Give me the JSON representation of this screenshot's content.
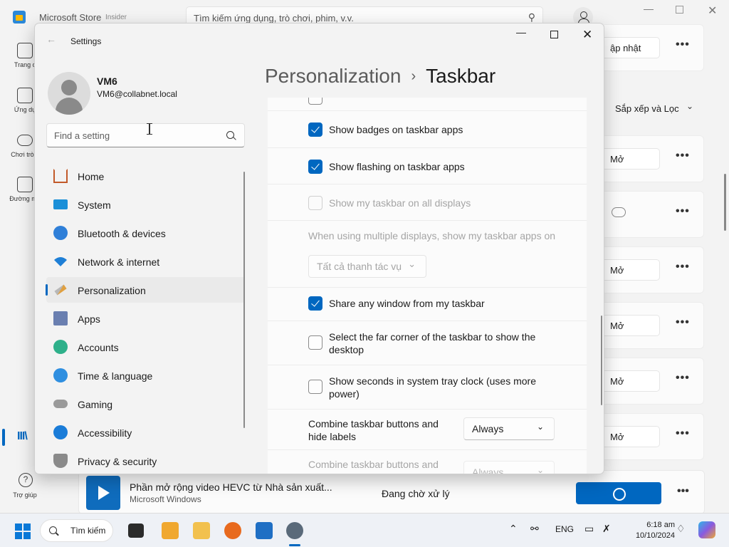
{
  "store": {
    "title": "Microsoft Store",
    "badge": "Insider",
    "search_placeholder": "Tìm kiếm ứng dụng, trò chơi, phim, v.v.",
    "nav": [
      {
        "label": "Trang c",
        "icon": "home-icon"
      },
      {
        "label": "Ứng dụ",
        "icon": "apps-icon"
      },
      {
        "label": "Chơi trò c",
        "icon": "gaming-icon"
      },
      {
        "label": "Đường mà",
        "icon": "movies-icon"
      }
    ],
    "help_label": "Trợ giúp",
    "update_label": "ập nhật",
    "sort_label": "Sắp xếp và Lọc",
    "open_label": "Mở",
    "more_label": "•••",
    "bottom_item": {
      "name": "Phần mở rộng video HEVC từ Nhà sản xuất...",
      "publisher": "Microsoft Windows",
      "status": "Đang chờ xử lý"
    }
  },
  "settings": {
    "window_title": "Settings",
    "user": {
      "name": "VM6",
      "email": "VM6@collabnet.local"
    },
    "search_placeholder": "Find a setting",
    "breadcrumb": {
      "parent": "Personalization",
      "separator": "›",
      "current": "Taskbar"
    },
    "nav": [
      {
        "label": "Home",
        "icon": "home-icon"
      },
      {
        "label": "System",
        "icon": "system-icon"
      },
      {
        "label": "Bluetooth & devices",
        "icon": "bluetooth-icon"
      },
      {
        "label": "Network & internet",
        "icon": "wifi-icon"
      },
      {
        "label": "Personalization",
        "icon": "brush-icon",
        "active": true
      },
      {
        "label": "Apps",
        "icon": "apps-icon"
      },
      {
        "label": "Accounts",
        "icon": "accounts-icon"
      },
      {
        "label": "Time & language",
        "icon": "globe-icon"
      },
      {
        "label": "Gaming",
        "icon": "controller-icon"
      },
      {
        "label": "Accessibility",
        "icon": "accessibility-icon"
      },
      {
        "label": "Privacy & security",
        "icon": "shield-icon"
      }
    ],
    "options": [
      {
        "label": "Show badges on taskbar apps",
        "checked": true,
        "enabled": true
      },
      {
        "label": "Show flashing on taskbar apps",
        "checked": true,
        "enabled": true
      },
      {
        "label": "Show my taskbar on all displays",
        "checked": false,
        "enabled": false
      },
      {
        "label": "When using multiple displays, show my taskbar apps on",
        "dropdown_value": "Tất cả thanh tác vụ",
        "enabled": false
      },
      {
        "label": "Share any window from my taskbar",
        "checked": true,
        "enabled": true
      },
      {
        "label": "Select the far corner of the taskbar to show the desktop",
        "checked": false,
        "enabled": true
      },
      {
        "label": "Show seconds in system tray clock (uses more power)",
        "checked": false,
        "enabled": true
      },
      {
        "label": "Combine taskbar buttons and hide labels",
        "dropdown_value": "Always",
        "enabled": true
      },
      {
        "label": "Combine taskbar buttons and",
        "dropdown_value": "Always",
        "enabled": false
      }
    ]
  },
  "taskbar": {
    "search_label": "Tìm kiếm",
    "tray_lang": "ENG",
    "time": "6:18 am",
    "date": "10/10/2024"
  }
}
